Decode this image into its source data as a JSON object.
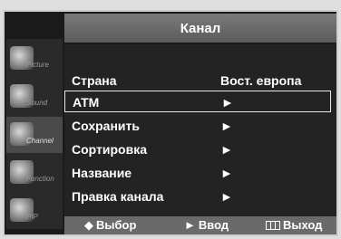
{
  "menu": {
    "title": "Канал"
  },
  "sidebar": {
    "items": [
      {
        "label": "Picture",
        "icon": "picture-icon",
        "active": false
      },
      {
        "label": "Sound",
        "icon": "sound-icon",
        "active": false
      },
      {
        "label": "Channel",
        "icon": "channel-icon",
        "active": true
      },
      {
        "label": "Function",
        "icon": "function-icon",
        "active": false
      },
      {
        "label": "PIP",
        "icon": "pip-icon",
        "active": false
      }
    ]
  },
  "rows": [
    {
      "label": "Страна",
      "value": "Вост. европа"
    },
    {
      "label": "ATM",
      "value": "►"
    },
    {
      "label": "Сохранить",
      "value": "►"
    },
    {
      "label": "Сортировка",
      "value": "►"
    },
    {
      "label": "Название",
      "value": "►"
    },
    {
      "label": "Правка канала",
      "value": "►"
    }
  ],
  "footer": {
    "select_icon": "◆",
    "select_label": "Выбор",
    "enter_icon": "►",
    "enter_label": "Ввод",
    "exit_icon": "menu-icon",
    "exit_label": "Выход"
  }
}
